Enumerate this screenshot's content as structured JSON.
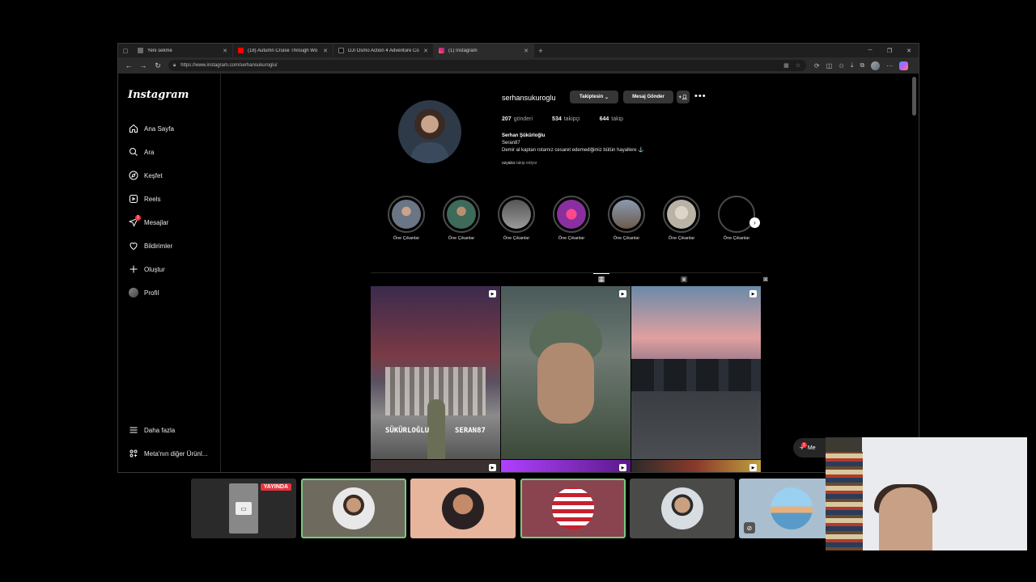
{
  "browser": {
    "tabs": [
      {
        "label": "Yeni sekme",
        "icon": "newtab-icon",
        "color": "#6b6b6b"
      },
      {
        "label": "(18) Autumn Cruise Through Wo",
        "icon": "youtube-icon",
        "color": "#ff0000"
      },
      {
        "label": "DJI Osmo Action 4 Adventure Co",
        "icon": "dji-icon",
        "color": "#111111"
      },
      {
        "label": "(1) Instagram",
        "icon": "instagram-icon",
        "color": "#e1306c"
      }
    ],
    "url": "https://www.instagram.com/serhansukuroglu/"
  },
  "sidebar": {
    "logo": "Instagram",
    "items": [
      {
        "label": "Ana Sayfa",
        "icon": "home-icon"
      },
      {
        "label": "Ara",
        "icon": "search-icon"
      },
      {
        "label": "Keşfet",
        "icon": "explore-icon"
      },
      {
        "label": "Reels",
        "icon": "reels-icon"
      },
      {
        "label": "Mesajlar",
        "icon": "messenger-icon",
        "badge": "1"
      },
      {
        "label": "Bildirimler",
        "icon": "heart-icon"
      },
      {
        "label": "Oluştur",
        "icon": "plus-icon"
      },
      {
        "label": "Profil",
        "icon": "avatar"
      }
    ],
    "bottom": [
      {
        "label": "Daha fazla",
        "icon": "menu-icon"
      },
      {
        "label": "Meta'nın diğer Ürünl...",
        "icon": "meta-icon"
      }
    ]
  },
  "profile": {
    "username": "serhansukuroglu",
    "follow_button": "Takiptesin",
    "message_button": "Mesaj Gönder",
    "stats": [
      {
        "value": "207",
        "label": "gönderi"
      },
      {
        "value": "534",
        "label": "takipçi"
      },
      {
        "value": "644",
        "label": "takip"
      }
    ],
    "bio_name": "Serhan Şükürloğlu",
    "bio_line1": "Seran87",
    "bio_line2": "Demir al kaptan rotamız cesaret edemediğimiz bütün hayallere ⚓",
    "followed_by_user": "ozyalcs",
    "followed_by_text": " takip ediyor"
  },
  "highlights": [
    {
      "label": "Öne Çıkanlar",
      "color": "#6a7686"
    },
    {
      "label": "Öne Çıkanlar",
      "color": "#3e6a5a"
    },
    {
      "label": "Öne Çıkanlar",
      "color": "#7a7a7a"
    },
    {
      "label": "Öne Çıkanlar",
      "color": "#8a2fa0"
    },
    {
      "label": "Öne Çıkanlar",
      "color": "#6b5a4e"
    },
    {
      "label": "Öne Çıkanlar",
      "color": "#b9b3a6"
    },
    {
      "label": "Öne Çıkanlar",
      "color": "#000000"
    }
  ],
  "post_texts": {
    "post1_left": "SÜKÜRLOĞLU",
    "post1_right": "SERAN87"
  },
  "floating_messages": {
    "label": "Me",
    "badge": "1"
  },
  "call": {
    "live_label": "YAYINDA"
  }
}
